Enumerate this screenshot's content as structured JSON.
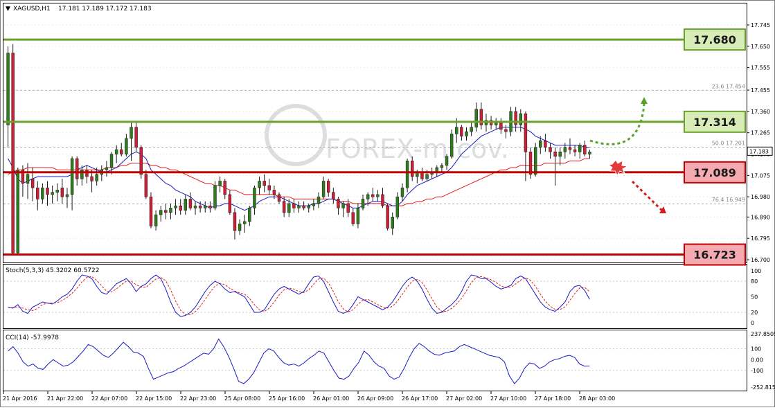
{
  "header": {
    "symbol_label": "XAGUSD,H1",
    "ohlc_label": "17.181 17.189 17.172 17.183"
  },
  "watermark": "FOREX-m.cov.",
  "colors": {
    "support_resistance_green": "#6aa12a",
    "support_resistance_red": "#c00000",
    "bull_candle": "#2e7d1d",
    "bear_candle": "#cc1f36",
    "ma_fast": "#1a1ac0",
    "ma_slow": "#e02020",
    "stoch_signal": "#e02020",
    "cci_line": "#1a1ac0",
    "green_box_fill": "#d8ecb8",
    "red_box_fill": "#f4aab0"
  },
  "chart_data": [
    {
      "type": "candlestick",
      "symbol": "XAGUSD",
      "timeframe": "H1",
      "ylim": [
        16.7,
        17.7
      ],
      "y_ticks": [
        "17.745",
        "17.650",
        "17.555",
        "17.455",
        "17.360",
        "17.265",
        "17.170",
        "17.075",
        "16.980",
        "16.890",
        "16.795",
        "16.700"
      ],
      "current_price": "17.183",
      "x_tick_labels": [
        "21 Apr 2016",
        "21 Apr 22:00",
        "22 Apr 07:00",
        "22 Apr 15:00",
        "22 Apr 23:00",
        "25 Apr 08:00",
        "25 Apr 16:00",
        "26 Apr 01:00",
        "26 Apr 09:00",
        "26 Apr 17:00",
        "27 Apr 02:00",
        "27 Apr 10:00",
        "27 Apr 18:00",
        "28 Apr 03:00"
      ],
      "candles": [
        [
          17.3,
          17.65,
          17.2,
          17.62
        ],
        [
          17.62,
          17.66,
          16.72,
          16.73
        ],
        [
          16.73,
          17.11,
          16.72,
          17.1
        ],
        [
          17.1,
          17.12,
          16.98,
          17.04
        ],
        [
          17.04,
          17.13,
          16.97,
          17.08
        ],
        [
          17.06,
          17.11,
          16.96,
          17.02
        ],
        [
          17.02,
          17.05,
          16.92,
          16.97
        ],
        [
          16.97,
          17.04,
          16.95,
          17.02
        ],
        [
          17.02,
          17.05,
          16.94,
          16.99
        ],
        [
          16.99,
          17.03,
          16.95,
          17.0
        ],
        [
          17.0,
          17.04,
          16.96,
          17.01
        ],
        [
          17.02,
          17.06,
          16.95,
          16.98
        ],
        [
          16.98,
          17.02,
          16.93,
          16.99
        ],
        [
          16.99,
          17.16,
          16.92,
          17.15
        ],
        [
          17.15,
          17.16,
          17.03,
          17.06
        ],
        [
          17.06,
          17.12,
          17.03,
          17.1
        ],
        [
          17.1,
          17.12,
          17.04,
          17.07
        ],
        [
          17.07,
          17.1,
          17.0,
          17.05
        ],
        [
          17.05,
          17.11,
          17.03,
          17.08
        ],
        [
          17.08,
          17.12,
          17.05,
          17.1
        ],
        [
          17.1,
          17.14,
          17.07,
          17.11
        ],
        [
          17.11,
          17.18,
          17.08,
          17.17
        ],
        [
          17.17,
          17.21,
          17.13,
          17.19
        ],
        [
          17.19,
          17.22,
          17.16,
          17.17
        ],
        [
          17.17,
          17.26,
          17.16,
          17.24
        ],
        [
          17.24,
          17.31,
          17.14,
          17.29
        ],
        [
          17.29,
          17.31,
          17.18,
          17.2
        ],
        [
          17.2,
          17.21,
          17.06,
          17.08
        ],
        [
          17.08,
          17.1,
          16.97,
          16.98
        ],
        [
          16.98,
          17.0,
          16.84,
          16.85
        ],
        [
          16.85,
          16.92,
          16.83,
          16.9
        ],
        [
          16.9,
          16.94,
          16.87,
          16.92
        ],
        [
          16.92,
          16.95,
          16.88,
          16.91
        ],
        [
          16.91,
          16.95,
          16.88,
          16.93
        ],
        [
          16.93,
          16.97,
          16.9,
          16.94
        ],
        [
          16.94,
          16.97,
          16.9,
          16.92
        ],
        [
          16.92,
          16.99,
          16.9,
          16.97
        ],
        [
          16.97,
          17.0,
          16.92,
          16.93
        ],
        [
          16.93,
          16.96,
          16.9,
          16.94
        ],
        [
          16.94,
          16.96,
          16.91,
          16.93
        ],
        [
          16.93,
          16.96,
          16.91,
          16.94
        ],
        [
          16.94,
          16.96,
          16.91,
          16.93
        ],
        [
          16.93,
          17.05,
          16.92,
          17.03
        ],
        [
          17.03,
          17.07,
          17.0,
          17.05
        ],
        [
          17.05,
          17.06,
          16.97,
          16.99
        ],
        [
          16.99,
          17.01,
          16.9,
          16.91
        ],
        [
          16.91,
          16.93,
          16.79,
          16.83
        ],
        [
          16.83,
          16.88,
          16.81,
          16.86
        ],
        [
          16.86,
          16.9,
          16.82,
          16.87
        ],
        [
          16.87,
          16.94,
          16.85,
          16.93
        ],
        [
          16.93,
          17.03,
          16.9,
          17.02
        ],
        [
          17.02,
          17.07,
          16.99,
          17.05
        ],
        [
          17.05,
          17.08,
          17.0,
          17.03
        ],
        [
          17.03,
          17.06,
          16.99,
          17.01
        ],
        [
          17.01,
          17.03,
          16.97,
          16.99
        ],
        [
          16.99,
          17.0,
          16.95,
          16.96
        ],
        [
          16.96,
          16.98,
          16.89,
          16.91
        ],
        [
          16.91,
          16.97,
          16.89,
          16.95
        ],
        [
          16.95,
          16.97,
          16.91,
          16.93
        ],
        [
          16.93,
          16.96,
          16.91,
          16.94
        ],
        [
          16.94,
          16.96,
          16.92,
          16.93
        ],
        [
          16.93,
          16.95,
          16.91,
          16.94
        ],
        [
          16.94,
          16.97,
          16.92,
          16.95
        ],
        [
          16.95,
          17.0,
          16.93,
          16.98
        ],
        [
          16.98,
          17.07,
          16.97,
          17.05
        ],
        [
          17.05,
          17.06,
          16.98,
          17.0
        ],
        [
          17.0,
          17.02,
          16.95,
          16.97
        ],
        [
          16.97,
          16.98,
          16.9,
          16.93
        ],
        [
          16.93,
          16.96,
          16.89,
          16.95
        ],
        [
          16.95,
          16.97,
          16.89,
          16.91
        ],
        [
          16.91,
          16.93,
          16.85,
          16.86
        ],
        [
          16.86,
          16.95,
          16.84,
          16.93
        ],
        [
          16.93,
          16.99,
          16.92,
          16.97
        ],
        [
          16.97,
          17.0,
          16.94,
          16.99
        ],
        [
          16.99,
          17.02,
          16.96,
          16.98
        ],
        [
          16.98,
          17.01,
          16.96,
          16.99
        ],
        [
          16.99,
          17.02,
          16.93,
          16.94
        ],
        [
          16.94,
          16.95,
          16.83,
          16.84
        ],
        [
          16.84,
          16.91,
          16.81,
          16.89
        ],
        [
          16.89,
          17.0,
          16.88,
          16.98
        ],
        [
          16.98,
          17.04,
          16.96,
          17.02
        ],
        [
          17.02,
          17.15,
          17.0,
          17.14
        ],
        [
          17.14,
          17.16,
          17.05,
          17.07
        ],
        [
          17.07,
          17.1,
          17.04,
          17.09
        ],
        [
          17.09,
          17.11,
          17.05,
          17.06
        ],
        [
          17.06,
          17.1,
          17.05,
          17.08
        ],
        [
          17.08,
          17.11,
          17.06,
          17.09
        ],
        [
          17.09,
          17.12,
          17.07,
          17.11
        ],
        [
          17.11,
          17.13,
          17.09,
          17.12
        ],
        [
          17.12,
          17.17,
          17.1,
          17.16
        ],
        [
          17.16,
          17.28,
          17.15,
          17.26
        ],
        [
          17.26,
          17.33,
          17.22,
          17.29
        ],
        [
          17.29,
          17.3,
          17.23,
          17.25
        ],
        [
          17.25,
          17.29,
          17.23,
          17.27
        ],
        [
          17.27,
          17.31,
          17.25,
          17.29
        ],
        [
          17.29,
          17.4,
          17.27,
          17.37
        ],
        [
          17.37,
          17.4,
          17.28,
          17.3
        ],
        [
          17.3,
          17.35,
          17.27,
          17.32
        ],
        [
          17.32,
          17.34,
          17.28,
          17.3
        ],
        [
          17.3,
          17.33,
          17.28,
          17.31
        ],
        [
          17.31,
          17.33,
          17.26,
          17.28
        ],
        [
          17.28,
          17.3,
          17.24,
          17.27
        ],
        [
          17.27,
          17.38,
          17.25,
          17.36
        ],
        [
          17.36,
          17.38,
          17.27,
          17.3
        ],
        [
          17.3,
          17.37,
          17.27,
          17.35
        ],
        [
          17.35,
          17.36,
          17.05,
          17.18
        ],
        [
          17.18,
          17.2,
          17.06,
          17.08
        ],
        [
          17.08,
          17.22,
          17.07,
          17.2
        ],
        [
          17.2,
          17.25,
          17.17,
          17.23
        ],
        [
          17.23,
          17.26,
          17.18,
          17.2
        ],
        [
          17.2,
          17.22,
          17.15,
          17.18
        ],
        [
          17.18,
          17.2,
          17.03,
          17.16
        ],
        [
          17.16,
          17.2,
          17.12,
          17.18
        ],
        [
          17.18,
          17.22,
          17.15,
          17.2
        ],
        [
          17.2,
          17.24,
          17.17,
          17.19
        ],
        [
          17.19,
          17.21,
          17.16,
          17.18
        ],
        [
          17.18,
          17.22,
          17.15,
          17.21
        ],
        [
          17.21,
          17.23,
          17.16,
          17.17
        ],
        [
          17.17,
          17.19,
          17.15,
          17.18
        ]
      ],
      "ma_fast": [
        17.15,
        17.11,
        17.06,
        17.04,
        17.05,
        17.06,
        17.07,
        17.07,
        17.07,
        17.07,
        17.07,
        17.07,
        17.07,
        17.08,
        17.1,
        17.11,
        17.12,
        17.11,
        17.1,
        17.09,
        17.09,
        17.1,
        17.11,
        17.13,
        17.15,
        17.17,
        17.18,
        17.17,
        17.15,
        17.1,
        17.08,
        17.06,
        17.04,
        17.03,
        17.01,
        17.0,
        16.99,
        16.98,
        16.96,
        16.95,
        16.94,
        16.93,
        16.94,
        16.94,
        16.95,
        16.95,
        16.94,
        16.93,
        16.92,
        16.93,
        16.94,
        16.96,
        16.97,
        16.98,
        16.98,
        16.98,
        16.97,
        16.96,
        16.95,
        16.94,
        16.94,
        16.94,
        16.95,
        16.95,
        16.96,
        16.97,
        16.97,
        16.96,
        16.95,
        16.94,
        16.93,
        16.93,
        16.94,
        16.95,
        16.96,
        16.96,
        16.96,
        16.95,
        16.94,
        16.94,
        16.96,
        16.99,
        17.01,
        17.03,
        17.04,
        17.05,
        17.06,
        17.07,
        17.08,
        17.09,
        17.11,
        17.14,
        17.17,
        17.19,
        17.21,
        17.23,
        17.25,
        17.26,
        17.27,
        17.28,
        17.29,
        17.29,
        17.29,
        17.29,
        17.29,
        17.28,
        17.27,
        17.25,
        17.24,
        17.23,
        17.22,
        17.21,
        17.21,
        17.21,
        17.21,
        17.21,
        17.21,
        17.2,
        17.2
      ],
      "ma_slow": [
        17.08,
        17.09,
        17.1,
        17.1,
        17.11,
        17.11,
        17.11,
        17.11,
        17.11,
        17.11,
        17.1,
        17.1,
        17.1,
        17.1,
        17.1,
        17.1,
        17.1,
        17.1,
        17.1,
        17.1,
        17.11,
        17.11,
        17.11,
        17.12,
        17.12,
        17.13,
        17.13,
        17.13,
        17.13,
        17.12,
        17.12,
        17.11,
        17.11,
        17.1,
        17.1,
        17.09,
        17.08,
        17.07,
        17.06,
        17.05,
        17.04,
        17.04,
        17.03,
        17.03,
        17.02,
        17.01,
        17.01,
        17.0,
        16.99,
        16.99,
        16.99,
        16.99,
        16.99,
        16.99,
        16.99,
        16.98,
        16.98,
        16.98,
        16.97,
        16.97,
        16.97,
        16.97,
        16.97,
        16.97,
        16.97,
        16.97,
        16.97,
        16.96,
        16.96,
        16.96,
        16.95,
        16.95,
        16.95,
        16.95,
        16.95,
        16.95,
        16.95,
        16.94,
        16.94,
        16.94,
        16.94,
        16.95,
        16.95,
        16.96,
        16.96,
        16.97,
        16.97,
        16.98,
        16.98,
        16.99,
        17.0,
        17.01,
        17.02,
        17.03,
        17.04,
        17.05,
        17.06,
        17.07,
        17.08,
        17.09,
        17.1,
        17.1,
        17.11,
        17.11,
        17.12,
        17.12,
        17.12,
        17.12,
        17.12,
        17.13,
        17.13,
        17.13,
        17.13,
        17.13,
        17.14,
        17.14,
        17.14,
        17.15,
        17.15
      ],
      "levels": [
        {
          "label": "17.680",
          "value": 17.68,
          "color": "green"
        },
        {
          "label": "17.314",
          "value": 17.314,
          "color": "green"
        },
        {
          "label": "17.089",
          "value": 17.089,
          "color": "red"
        },
        {
          "label": "16.723",
          "value": 16.723,
          "color": "red"
        }
      ],
      "fibonacci": [
        {
          "label": "23.6  17.454",
          "value": 17.454
        },
        {
          "label": "50.0  17.201",
          "value": 17.201
        },
        {
          "label": "76.4  16.949",
          "value": 16.949
        }
      ]
    },
    {
      "type": "line",
      "title": "Stoch(5,3,3) 45.3202 60.5722",
      "ylim": [
        0,
        100
      ],
      "y_ticks": [
        "100",
        "80",
        "50",
        "20",
        "0"
      ],
      "main": [
        30,
        28,
        35,
        22,
        18,
        30,
        35,
        40,
        38,
        36,
        42,
        50,
        55,
        65,
        80,
        92,
        90,
        85,
        70,
        58,
        55,
        65,
        75,
        80,
        85,
        75,
        60,
        70,
        75,
        85,
        92,
        85,
        65,
        40,
        20,
        12,
        14,
        20,
        30,
        45,
        60,
        72,
        80,
        75,
        65,
        58,
        60,
        55,
        50,
        35,
        20,
        20,
        25,
        40,
        55,
        65,
        70,
        65,
        60,
        55,
        60,
        75,
        88,
        90,
        80,
        60,
        40,
        22,
        18,
        22,
        35,
        50,
        45,
        40,
        35,
        30,
        25,
        30,
        40,
        55,
        70,
        82,
        88,
        80,
        65,
        45,
        28,
        18,
        20,
        28,
        35,
        45,
        60,
        80,
        92,
        90,
        85,
        85,
        78,
        70,
        65,
        68,
        72,
        85,
        90,
        85,
        70,
        55,
        40,
        30,
        25,
        22,
        30,
        40,
        60,
        70,
        72,
        62,
        45
      ]
    },
    {
      "type": "line",
      "title": "CCI(14) -57.9978",
      "ylim": [
        -252.8155,
        237.8505
      ],
      "y_ticks": [
        "237.8505",
        "100",
        "0.00",
        "-100",
        "-252.8155"
      ],
      "values": [
        80,
        120,
        60,
        -20,
        -60,
        -40,
        -80,
        -90,
        -40,
        0,
        -30,
        -60,
        -50,
        -20,
        30,
        80,
        140,
        120,
        80,
        40,
        20,
        60,
        110,
        160,
        120,
        70,
        60,
        30,
        -80,
        -180,
        -160,
        -140,
        -120,
        -110,
        -80,
        -60,
        -30,
        0,
        30,
        60,
        50,
        100,
        190,
        120,
        30,
        -80,
        -200,
        -220,
        -180,
        -120,
        -30,
        60,
        100,
        80,
        20,
        -30,
        -50,
        -40,
        -60,
        -30,
        10,
        40,
        80,
        60,
        -20,
        -100,
        -170,
        -180,
        -150,
        -80,
        -20,
        80,
        40,
        -20,
        -60,
        -80,
        -150,
        -180,
        -160,
        -80,
        20,
        100,
        150,
        120,
        80,
        50,
        40,
        60,
        70,
        80,
        120,
        140,
        120,
        100,
        80,
        60,
        40,
        30,
        20,
        -20,
        -150,
        -220,
        -170,
        -80,
        -30,
        -40,
        -80,
        -60,
        -20,
        0,
        10,
        30,
        40,
        20,
        -40,
        -60,
        -58
      ]
    }
  ]
}
